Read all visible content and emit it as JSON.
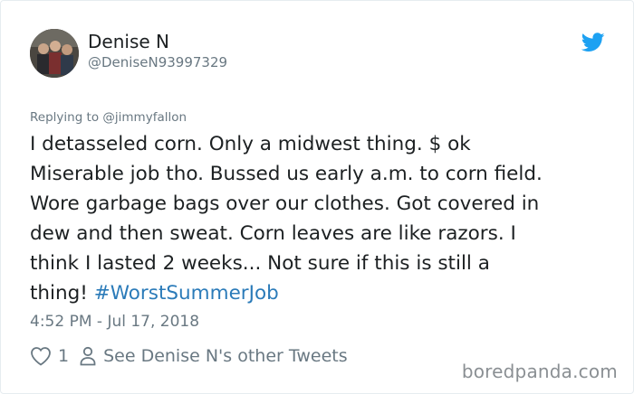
{
  "author": {
    "display_name": "Denise N",
    "handle": "@DeniseN93997329"
  },
  "tweet": {
    "replying_label": "Replying to",
    "replying_to": "@jimmyfallon",
    "text_lines": [
      "I detasseled corn. Only a midwest thing. $ ok",
      "Miserable job tho. Bussed us early a.m. to corn field.",
      "Wore garbage bags over our clothes. Got covered in",
      "dew and then sweat. Corn leaves are like razors. I",
      "think I lasted 2 weeks... Not sure if this is still a",
      "thing! "
    ],
    "hashtag": "#WorstSummerJob",
    "timestamp": "4:52 PM - Jul 17, 2018"
  },
  "actions": {
    "like_count": "1",
    "see_more": "See Denise N's other Tweets"
  },
  "icons": {
    "brand": "twitter-bird-icon",
    "like": "heart-icon",
    "profile": "person-icon"
  },
  "colors": {
    "twitter_blue": "#1da1f2",
    "link": "#2b7bb9",
    "muted": "#697882",
    "text": "#1c2022"
  },
  "watermark": "boredpanda.com"
}
